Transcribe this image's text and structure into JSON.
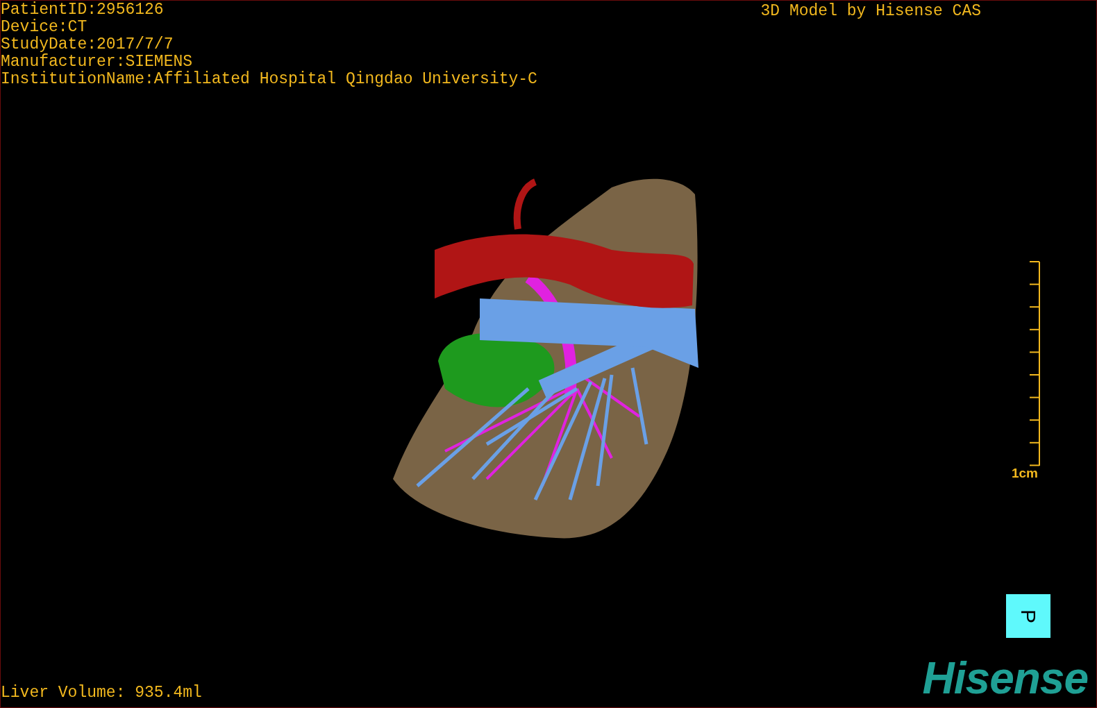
{
  "patient_info": [
    "PatientID:2956126",
    "Device:CT",
    "StudyDate:2017/7/7",
    "Manufacturer:SIEMENS",
    "InstitutionName:Affiliated Hospital Qingdao University-C"
  ],
  "model_title": "3D Model by Hisense CAS",
  "scale_bar": {
    "label": "1cm"
  },
  "liver_volume": "Liver Volume: 935.4ml",
  "orientation_cube": {
    "label": "P"
  },
  "logo": "Hisense"
}
